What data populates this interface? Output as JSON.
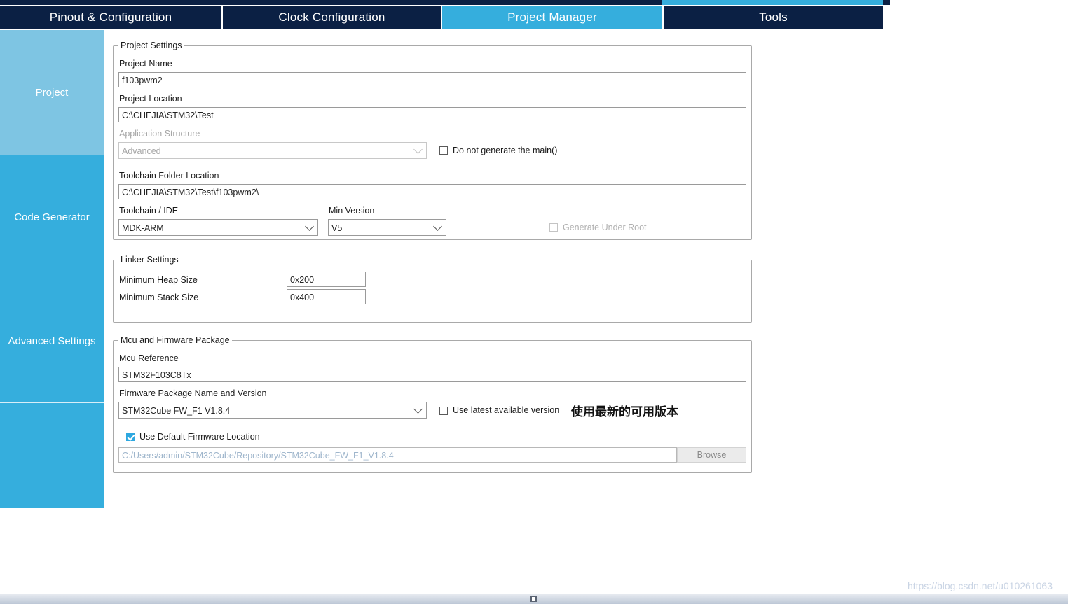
{
  "window": {
    "tabs": [
      {
        "label": "Pinout & Configuration",
        "active": false
      },
      {
        "label": "Clock Configuration",
        "active": false
      },
      {
        "label": "Project Manager",
        "active": true
      },
      {
        "label": "Tools",
        "active": false
      }
    ]
  },
  "sidebar": {
    "items": [
      {
        "label": "Project",
        "selected": true
      },
      {
        "label": "Code Generator",
        "selected": false
      },
      {
        "label": "Advanced Settings",
        "selected": false
      },
      {
        "label": "",
        "selected": false
      }
    ]
  },
  "project_settings": {
    "title": "Project Settings",
    "project_name_label": "Project Name",
    "project_name_value": "f103pwm2",
    "project_location_label": "Project Location",
    "project_location_value": "C:\\CHEJIA\\STM32\\Test",
    "application_structure_label": "Application Structure",
    "application_structure_value": "Advanced",
    "do_not_generate_main_label": "Do not generate the main()",
    "do_not_generate_main_checked": false,
    "toolchain_folder_label": "Toolchain Folder Location",
    "toolchain_folder_value": "C:\\CHEJIA\\STM32\\Test\\f103pwm2\\",
    "toolchain_ide_label": "Toolchain / IDE",
    "toolchain_ide_value": "MDK-ARM",
    "min_version_label": "Min Version",
    "min_version_value": "V5",
    "generate_under_root_label": "Generate Under Root",
    "generate_under_root_checked": false
  },
  "linker_settings": {
    "title": "Linker Settings",
    "min_heap_label": "Minimum Heap Size",
    "min_heap_value": "0x200",
    "min_stack_label": "Minimum Stack Size",
    "min_stack_value": "0x400"
  },
  "mcu_firmware": {
    "title": "Mcu and Firmware Package",
    "mcu_reference_label": "Mcu Reference",
    "mcu_reference_value": "STM32F103C8Tx",
    "firmware_package_label": "Firmware Package Name and Version",
    "firmware_package_value": "STM32Cube FW_F1 V1.8.4",
    "use_latest_label": "Use latest available version",
    "use_latest_checked": false,
    "use_latest_annotation": "使用最新的可用版本",
    "use_default_location_label": "Use Default Firmware Location",
    "use_default_location_checked": true,
    "firmware_location_value": "C:/Users/admin/STM32Cube/Repository/STM32Cube_FW_F1_V1.8.4",
    "browse_label": "Browse"
  },
  "footer": {
    "watermark": "https://blog.csdn.net/u010261063"
  },
  "colors": {
    "tab_bar_bg": "#0b2044",
    "tab_active_bg": "#35aedd",
    "sidebar_bg": "#35aedd",
    "sidebar_selected_bg": "#7ec5e3",
    "checkbox_checked": "#2ea8e0",
    "readonly_text": "#9fb6cc",
    "watermark_text": "#c9d4e4"
  }
}
